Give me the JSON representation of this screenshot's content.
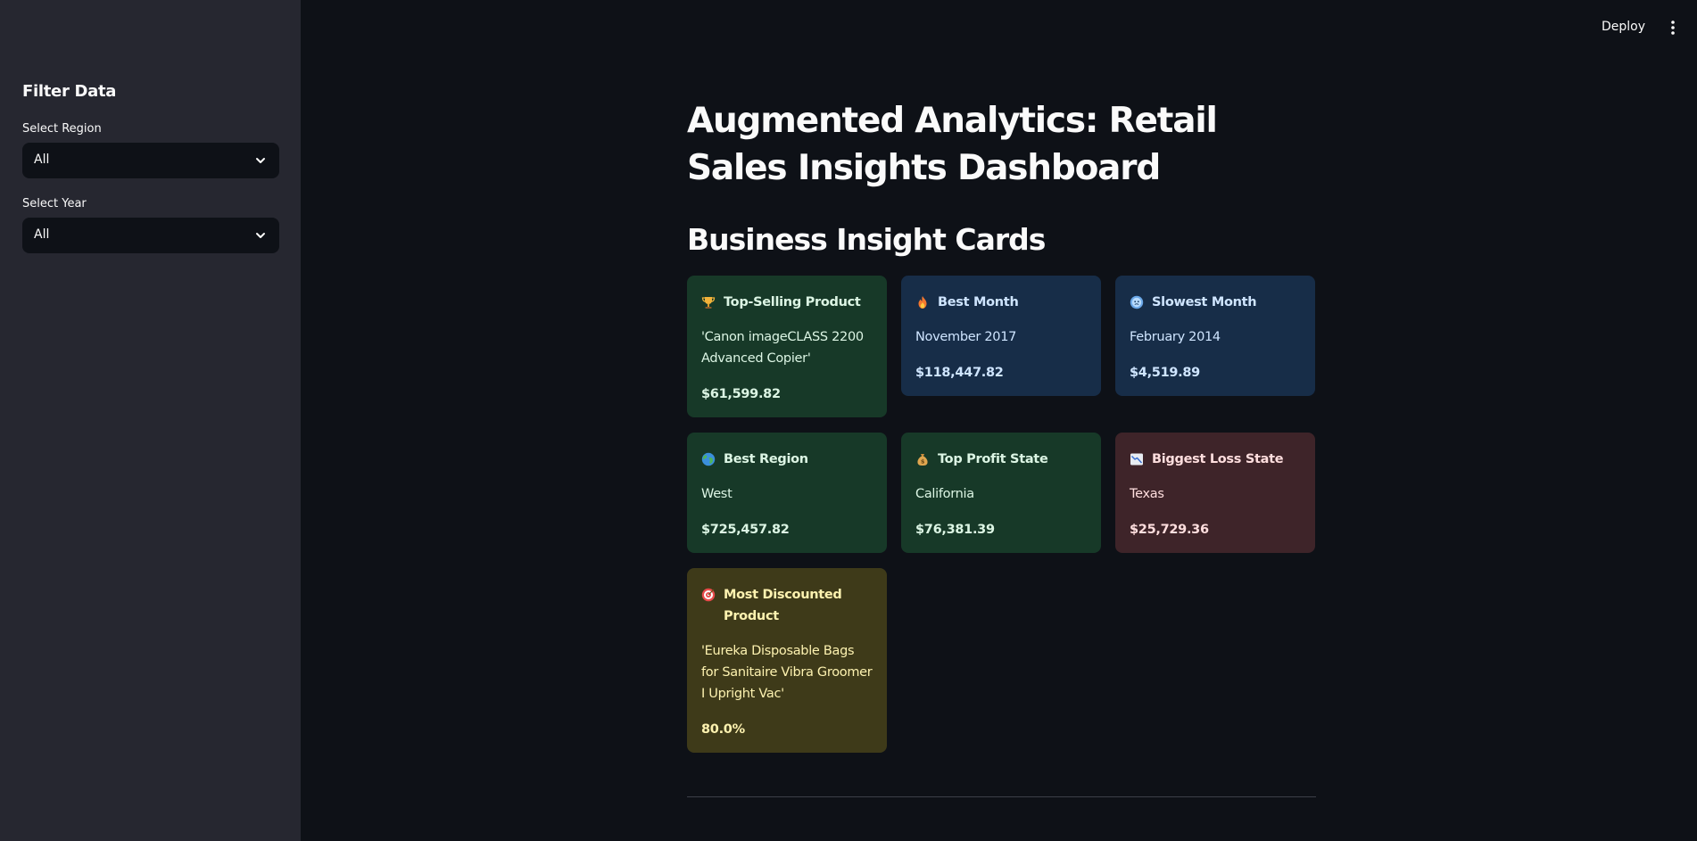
{
  "header": {
    "deploy_label": "Deploy",
    "menu_icon": "kebab-menu-icon"
  },
  "sidebar": {
    "title": "Filter Data",
    "region": {
      "label": "Select Region",
      "value": "All"
    },
    "year": {
      "label": "Select Year",
      "value": "All"
    }
  },
  "main": {
    "title": "Augmented Analytics: Retail Sales Insights Dashboard",
    "section_title": "Business Insight Cards",
    "cards": [
      {
        "icon": "trophy-icon",
        "title": "Top-Selling Product",
        "text": "'Canon imageCLASS 2200 Advanced Copier'",
        "value": "$61,599.82",
        "color": "#173928"
      },
      {
        "icon": "fire-icon",
        "title": "Best Month",
        "text": "November 2017",
        "value": "$118,447.82",
        "color": "#172d48"
      },
      {
        "icon": "snowflake-face-icon",
        "title": "Slowest Month",
        "text": "February 2014",
        "value": "$4,519.89",
        "color": "#172d48"
      },
      {
        "icon": "globe-icon",
        "title": "Best Region",
        "text": "West",
        "value": "$725,457.82",
        "color": "#173928"
      },
      {
        "icon": "money-bag-icon",
        "title": "Top Profit State",
        "text": "California",
        "value": "$76,381.39",
        "color": "#173928"
      },
      {
        "icon": "chart-decreasing-icon",
        "title": "Biggest Loss State",
        "text": "Texas",
        "value": "$25,729.36",
        "color": "#3e2429"
      },
      {
        "icon": "target-icon",
        "title": "Most Discounted Product",
        "text": "'Eureka Disposable Bags for Sanitaire Vibra Groomer I Upright Vac'",
        "value": "80.0%",
        "color": "#3e3a19"
      }
    ]
  }
}
